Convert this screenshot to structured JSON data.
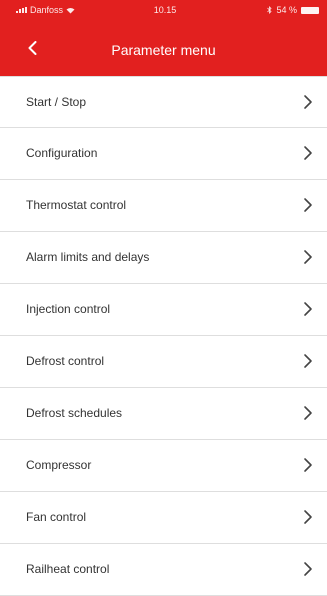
{
  "status_bar": {
    "carrier": "Danfoss",
    "time": "10.15",
    "battery": "54 %"
  },
  "header": {
    "title": "Parameter menu",
    "back_icon": "chevron-left-icon"
  },
  "menu": {
    "items": [
      {
        "label": "Start / Stop"
      },
      {
        "label": "Configuration"
      },
      {
        "label": "Thermostat control"
      },
      {
        "label": "Alarm limits and delays"
      },
      {
        "label": "Injection control"
      },
      {
        "label": "Defrost control"
      },
      {
        "label": "Defrost schedules"
      },
      {
        "label": "Compressor"
      },
      {
        "label": "Fan control"
      },
      {
        "label": "Railheat control"
      }
    ],
    "item_icon": "chevron-right-icon"
  },
  "colors": {
    "header_bg": "#e2201f",
    "text": "#333333",
    "divider": "#dedede"
  }
}
